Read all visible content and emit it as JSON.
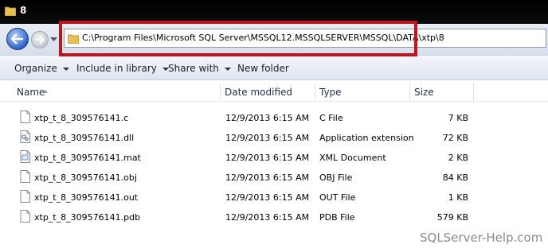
{
  "window": {
    "title": "8"
  },
  "nav": {
    "address": "C:\\Program Files\\Microsoft SQL Server\\MSSQL12.MSSQLSERVER\\MSSQL\\DATA\\xtp\\8"
  },
  "toolbar": {
    "organize": "Organize",
    "include": "Include in library",
    "share": "Share with",
    "new_folder": "New folder"
  },
  "columns": {
    "name": "Name",
    "date": "Date modified",
    "type": "Type",
    "size": "Size"
  },
  "files": [
    {
      "name": "xtp_t_8_309576141.c",
      "date": "12/9/2013 6:15 AM",
      "type": "C File",
      "size": "7 KB",
      "icon": "c-file-icon"
    },
    {
      "name": "xtp_t_8_309576141.dll",
      "date": "12/9/2013 6:15 AM",
      "type": "Application extension",
      "size": "72 KB",
      "icon": "dll-file-icon"
    },
    {
      "name": "xtp_t_8_309576141.mat",
      "date": "12/9/2013 6:15 AM",
      "type": "XML Document",
      "size": "2 KB",
      "icon": "xml-file-icon"
    },
    {
      "name": "xtp_t_8_309576141.obj",
      "date": "12/9/2013 6:15 AM",
      "type": "OBJ File",
      "size": "84 KB",
      "icon": "obj-file-icon"
    },
    {
      "name": "xtp_t_8_309576141.out",
      "date": "12/9/2013 6:15 AM",
      "type": "OUT File",
      "size": "1 KB",
      "icon": "out-file-icon"
    },
    {
      "name": "xtp_t_8_309576141.pdb",
      "date": "12/9/2013 6:15 AM",
      "type": "PDB File",
      "size": "579 KB",
      "icon": "pdb-file-icon"
    }
  ],
  "watermark": "SQLServer-Help.com",
  "colors": {
    "highlight": "#c0141c",
    "title_bar": "#000000"
  }
}
